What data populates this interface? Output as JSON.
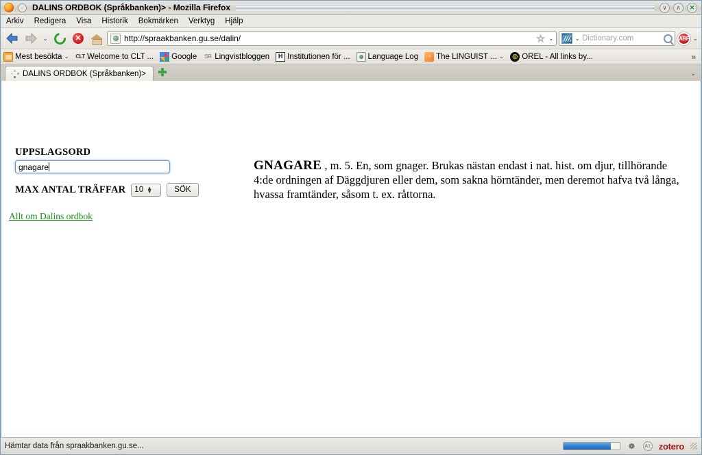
{
  "window": {
    "title": "DALINS ORDBOK (Språkbanken)> - Mozilla Firefox",
    "minimize_label": "∨",
    "maximize_label": "∧",
    "close_label": "✕"
  },
  "menubar": {
    "items": [
      "Arkiv",
      "Redigera",
      "Visa",
      "Historik",
      "Bokmärken",
      "Verktyg",
      "Hjälp"
    ]
  },
  "toolbar": {
    "back_label": "◀",
    "forward_label": "▶",
    "history_caret": "⌄",
    "reload_label": "",
    "stop_label": "✕",
    "home_label": "",
    "url": "http://spraakbanken.gu.se/dalin/",
    "star_label": "☆",
    "url_caret": "⌄",
    "search_engine_caret": "⌄",
    "search_placeholder": "Dictionary.com",
    "adblock_label": "ABP",
    "adblock_caret": "⌄"
  },
  "bookmarks": {
    "items": [
      {
        "label": "Mest besökta",
        "icon": "folder-icon",
        "caret": "⌄"
      },
      {
        "label": "Welcome to CLT ...",
        "icon": "clt-icon",
        "glyph": "CLT"
      },
      {
        "label": "Google",
        "icon": "google-icon"
      },
      {
        "label": "Lingvistbloggen",
        "icon": "sb-icon",
        "glyph": "SB"
      },
      {
        "label": "Institutionen för ...",
        "icon": "institution-icon",
        "glyph": "H"
      },
      {
        "label": "Language Log",
        "icon": "language-log-icon"
      },
      {
        "label": "The LINGUIST ...",
        "icon": "rss-icon",
        "glyph": "◔",
        "caret": "⌄"
      },
      {
        "label": "OREL - All links by...",
        "icon": "orel-icon",
        "glyph": "◎"
      }
    ],
    "overflow_label": "»"
  },
  "tabs": {
    "items": [
      {
        "label": "DALINS ORDBOK (Språkbanken)>",
        "icon": "loading-spinner-icon"
      }
    ],
    "new_tab_label": "✚",
    "list_caret": "⌄"
  },
  "page": {
    "form": {
      "headword_label": "UPPSLAGSORD",
      "search_value": "gnagare",
      "max_hits_label": "MAX ANTAL TRÄFFAR",
      "max_hits_value": "10",
      "submit_label": "SÖK"
    },
    "link_label": "Allt om Dalins ordbok",
    "entry": {
      "headword": "GNAGARE",
      "body": " , m. 5. En, som gnager. Brukas nästan endast i nat. hist. om djur, tillhörande 4:de ordningen af Däggdjuren eller dem, som sakna hörntänder, men deremot hafva två långa, hvassa framtänder, såsom t. ex. råttorna."
    }
  },
  "statusbar": {
    "text": "Hämtar data från spraakbanken.gu.se...",
    "progress_percent": 85,
    "zotero_label": "zotero",
    "sb_icon_glyph": "❁",
    "sb_circle_glyph": "A1"
  },
  "colors": {
    "accent_blue": "#2f7fd0",
    "link_green": "#1f8a1f",
    "focus_ring": "#6f97c4"
  }
}
